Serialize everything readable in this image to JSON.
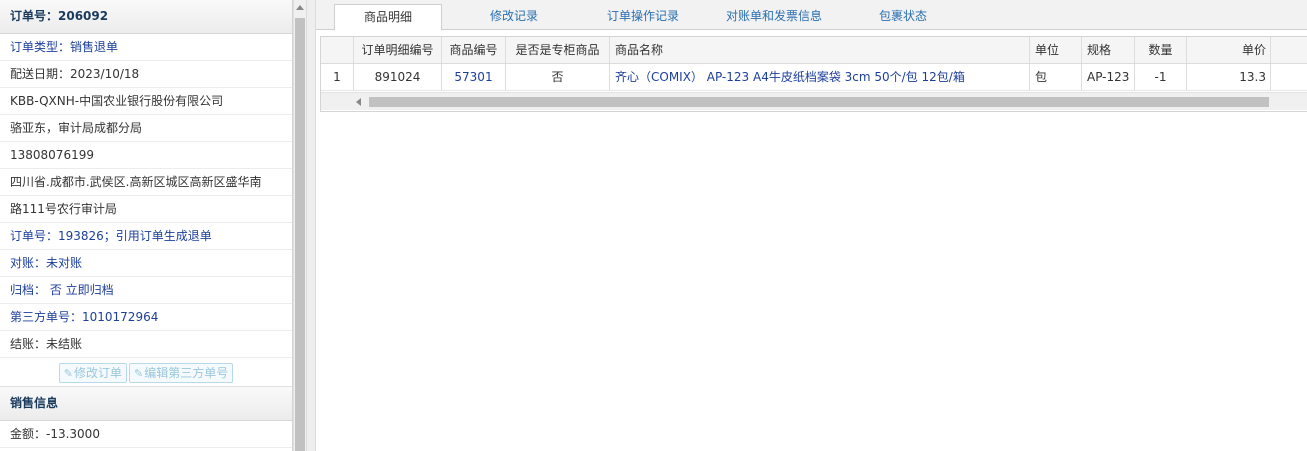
{
  "order_panel": {
    "title": "订单号：206092",
    "rows": [
      {
        "text": "订单类型：销售退单",
        "style": "blue"
      },
      {
        "text": "配送日期：2023/10/18",
        "style": "black"
      },
      {
        "text": "KBB-QXNH-中国农业银行股份有限公司",
        "style": "black"
      },
      {
        "text": "骆亚东，审计局成都分局",
        "style": "black"
      },
      {
        "text": "13808076199",
        "style": "black"
      },
      {
        "text": "四川省.成都市.武侯区.高新区城区高新区盛华南",
        "style": "black"
      },
      {
        "text": "路111号农行审计局",
        "style": "black"
      },
      {
        "text": "订单号：193826；引用订单生成退单",
        "style": "blue"
      },
      {
        "text": "对账：未对账",
        "style": "blue"
      },
      {
        "text": "归档： 否 立即归档",
        "style": "blue"
      },
      {
        "text": "第三方单号：1010172964",
        "style": "blue"
      },
      {
        "text": "结账：未结账",
        "style": "black"
      }
    ],
    "edit_order_button": "修改订单",
    "edit_third_party_button": "编辑第三方单号"
  },
  "sales_panel": {
    "title": "销售信息",
    "rows": [
      {
        "text": "金额：-13.3000",
        "style": "black"
      }
    ]
  },
  "tabs": [
    {
      "label": "商品明细",
      "active": true
    },
    {
      "label": "修改记录",
      "active": false
    },
    {
      "label": "订单操作记录",
      "active": false
    },
    {
      "label": "对账单和发票信息",
      "active": false
    },
    {
      "label": "包裹状态",
      "active": false
    }
  ],
  "grid": {
    "columns": [
      "",
      "订单明细编号",
      "商品编号",
      "是否是专柜商品",
      "商品名称",
      "单位",
      "规格",
      "数量",
      "单价"
    ],
    "rows": [
      [
        "1",
        "891024",
        "57301",
        "否",
        "齐心（COMIX） AP-123 A4牛皮纸档案袋 3cm 50个/包 12包/箱",
        "包",
        "AP-123",
        "-1",
        "13.3"
      ]
    ]
  },
  "icons": {
    "edit": "edit-icon",
    "scroll_up": "arrow-up-icon",
    "scroll_left": "arrow-left-icon"
  }
}
